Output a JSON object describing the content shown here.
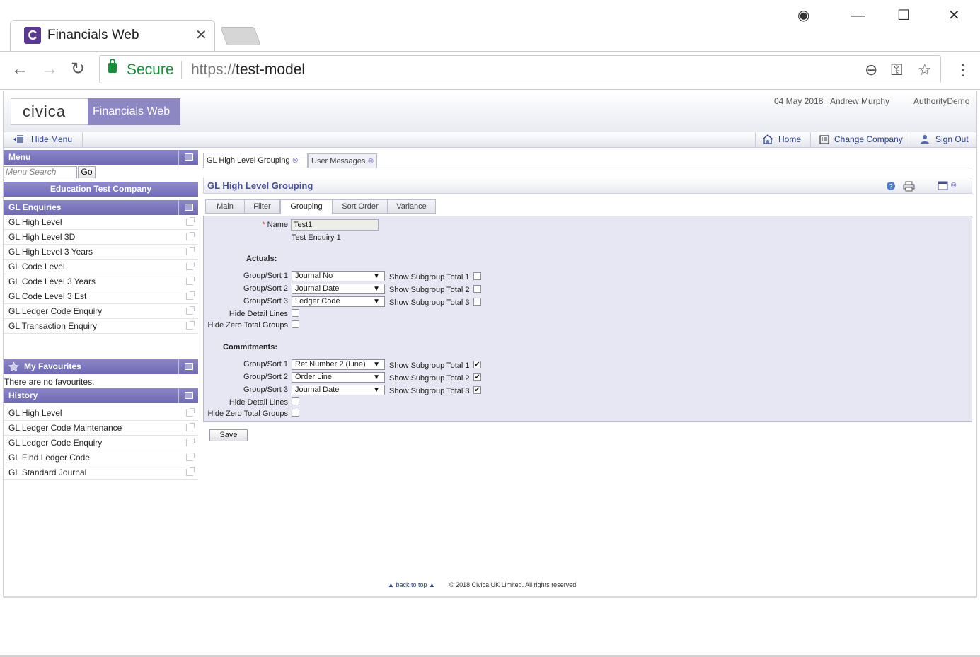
{
  "browser": {
    "tab_title": "Financials Web",
    "tab_favicon": "C",
    "tab_close": "✕",
    "secure_label": "Secure",
    "url_scheme": "https://",
    "url_host": "test-model"
  },
  "header": {
    "logo": "civica",
    "app_name": "Financials Web",
    "date": "04 May 2018",
    "user": "Andrew Murphy",
    "authority": "AuthorityDemo"
  },
  "menubar": {
    "hide_menu": "Hide Menu",
    "home": "Home",
    "change_company": "Change Company",
    "sign_out": "Sign Out"
  },
  "sidebar": {
    "menu_title": "Menu",
    "search_placeholder": "Menu Search",
    "go_label": "Go",
    "company": "Education Test Company",
    "section_title": "GL Enquiries",
    "items": [
      "GL High Level",
      "GL High Level 3D",
      "GL High Level 3 Years",
      "GL Code Level",
      "GL Code Level 3 Years",
      "GL Code Level 3 Est",
      "GL Ledger Code Enquiry",
      "GL Transaction Enquiry"
    ],
    "favourites_title": "My Favourites",
    "no_favourites": "There are no favourites.",
    "history_title": "History",
    "history": [
      "GL High Level",
      "GL Ledger Code Maintenance",
      "GL Ledger Code Enquiry",
      "GL Find Ledger Code",
      "GL Standard Journal"
    ]
  },
  "content": {
    "tabs": [
      "GL High Level Grouping",
      "User Messages"
    ],
    "panel_title": "GL High Level Grouping",
    "inner_tabs": [
      "Main",
      "Filter",
      "Grouping",
      "Sort Order",
      "Variance"
    ],
    "active_inner_tab": "Grouping",
    "name_label": "Name",
    "name_value": "Test1",
    "description": "Test Enquiry 1",
    "actuals": {
      "title": "Actuals:",
      "rows": [
        {
          "label": "Group/Sort 1",
          "value": "Journal No",
          "subtotal_label": "Show Subgroup Total 1",
          "checked": false
        },
        {
          "label": "Group/Sort 2",
          "value": "Journal Date",
          "subtotal_label": "Show Subgroup Total 2",
          "checked": false
        },
        {
          "label": "Group/Sort 3",
          "value": "Ledger Code",
          "subtotal_label": "Show Subgroup Total 3",
          "checked": false
        }
      ],
      "hide_detail_label": "Hide Detail Lines",
      "hide_zero_label": "Hide Zero Total Groups"
    },
    "commitments": {
      "title": "Commitments:",
      "rows": [
        {
          "label": "Group/Sort 1",
          "value": "Ref Number 2 (Line)",
          "subtotal_label": "Show Subgroup Total 1",
          "checked": true
        },
        {
          "label": "Group/Sort 2",
          "value": "Order Line",
          "subtotal_label": "Show Subgroup Total 2",
          "checked": true
        },
        {
          "label": "Group/Sort 3",
          "value": "Journal Date",
          "subtotal_label": "Show Subgroup Total 3",
          "checked": true
        }
      ],
      "hide_detail_label": "Hide Detail Lines",
      "hide_zero_label": "Hide Zero Total Groups"
    },
    "save_label": "Save"
  },
  "footer": {
    "back_to_top": "back to top",
    "copyright": "© 2018 Civica UK Limited. All rights reserved."
  },
  "colors": {
    "accent": "#8d87c4",
    "link": "#2b3f86",
    "secure": "#1e8e3e"
  }
}
